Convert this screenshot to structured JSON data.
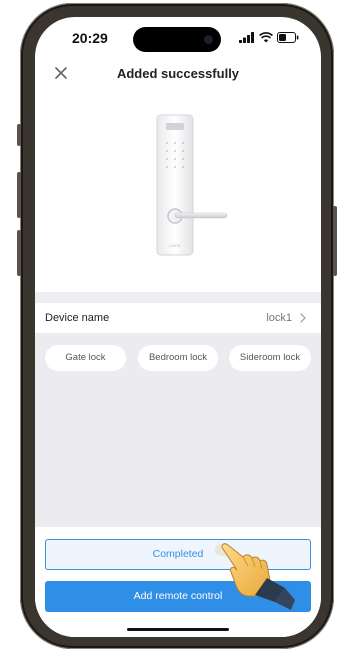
{
  "status_bar": {
    "time": "20:29",
    "icons": [
      "signal-icon",
      "wifi-icon",
      "battery-icon"
    ]
  },
  "header": {
    "title": "Added successfully",
    "close_icon": "close-icon"
  },
  "device_illustration": {
    "label": "LOCK"
  },
  "device": {
    "label": "Device name",
    "value": "lock1"
  },
  "name_suggestions": [
    "Gate lock",
    "Bedroom lock",
    "Sideroom lock"
  ],
  "actions": {
    "completed": "Completed",
    "add_remote": "Add remote control"
  },
  "colors": {
    "accent": "#2f8ee6",
    "accent_light_bg": "#eef5fd",
    "panel_grey": "#ebebf0"
  }
}
